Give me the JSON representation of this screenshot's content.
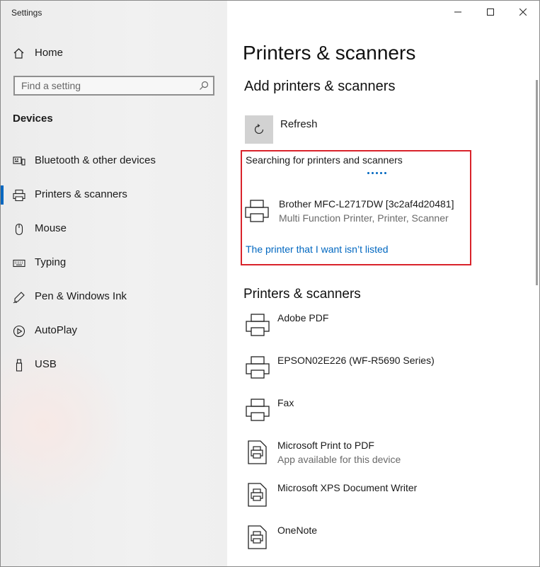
{
  "window": {
    "title": "Settings"
  },
  "sidebar": {
    "home_label": "Home",
    "search_placeholder": "Find a setting",
    "section_label": "Devices",
    "items": [
      {
        "label": "Bluetooth & other devices",
        "icon": "bluetooth-devices-icon",
        "selected": false
      },
      {
        "label": "Printers & scanners",
        "icon": "printer-icon",
        "selected": true
      },
      {
        "label": "Mouse",
        "icon": "mouse-icon",
        "selected": false
      },
      {
        "label": "Typing",
        "icon": "keyboard-icon",
        "selected": false
      },
      {
        "label": "Pen & Windows Ink",
        "icon": "pen-icon",
        "selected": false
      },
      {
        "label": "AutoPlay",
        "icon": "autoplay-icon",
        "selected": false
      },
      {
        "label": "USB",
        "icon": "usb-icon",
        "selected": false
      }
    ]
  },
  "main": {
    "page_title": "Printers & scanners",
    "add_heading": "Add printers & scanners",
    "refresh_label": "Refresh",
    "searching_text": "Searching for printers and scanners",
    "found_device": {
      "name": "Brother MFC-L2717DW [3c2af4d20481]",
      "description": "Multi Function Printer, Printer, Scanner"
    },
    "not_listed_link": "The printer that I want isn’t listed",
    "list_heading": "Printers & scanners",
    "devices": [
      {
        "name": "Adobe PDF",
        "sub": "",
        "icon": "printer-icon"
      },
      {
        "name": "EPSON02E226 (WF-R5690 Series)",
        "sub": "",
        "icon": "printer-icon"
      },
      {
        "name": "Fax",
        "sub": "",
        "icon": "printer-icon"
      },
      {
        "name": "Microsoft Print to PDF",
        "sub": "App available for this device",
        "icon": "printer-document-icon"
      },
      {
        "name": "Microsoft XPS Document Writer",
        "sub": "",
        "icon": "printer-document-icon"
      },
      {
        "name": "OneNote",
        "sub": "",
        "icon": "printer-document-icon"
      }
    ]
  },
  "colors": {
    "accent": "#0067c0",
    "highlight_border": "#d9232b",
    "refresh_bg": "#d2d2d2"
  }
}
